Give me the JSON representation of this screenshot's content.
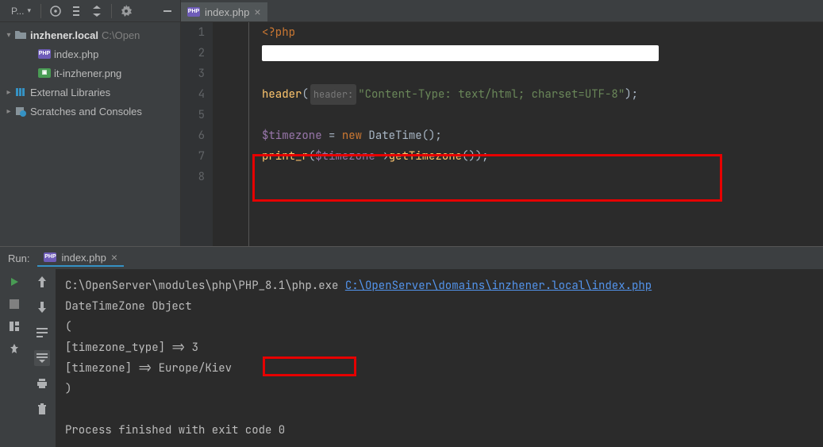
{
  "toolbar": {
    "project_label": "P...",
    "dropdown_icon": "chevron"
  },
  "tree": {
    "root": {
      "name": "inzhener.local",
      "path": "C:\\Open"
    },
    "files": [
      {
        "name": "index.php",
        "type": "php"
      },
      {
        "name": "it-inzhener.png",
        "type": "png"
      }
    ],
    "ext_lib": "External Libraries",
    "scratches": "Scratches and Consoles"
  },
  "tab": {
    "file": "index.php"
  },
  "code": {
    "lines": [
      "1",
      "2",
      "3",
      "4",
      "5",
      "6",
      "7",
      "8"
    ],
    "l1_open": "<?php",
    "l4_fn": "header",
    "l4_p1": "(",
    "l4_hint": "header:",
    "l4_str": "\"Content-Type: text/html; charset=UTF-8\"",
    "l4_p2": ");",
    "l6_var": "$timezone",
    "l6_eq": " = ",
    "l6_new": "new ",
    "l6_cls": "DateTime",
    "l6_end": "();",
    "l7_fn": "print_r",
    "l7_p1": "(",
    "l7_var": "$timezone",
    "l7_arrow": "->",
    "l7_method": "getTimezone",
    "l7_end": "());"
  },
  "run": {
    "title": "Run:",
    "tab_label": "index.php",
    "cmd_prefix": "C:\\OpenServer\\modules\\php\\PHP_8.1\\php.exe ",
    "cmd_link": "C:\\OpenServer\\domains\\inzhener.local\\index.php",
    "out1": "DateTimeZone Object",
    "out2": "(",
    "out3": "    [timezone_type] => 3",
    "out4a": "    [timezone] => ",
    "out4b": "Europe/Kiev",
    "out5": ")",
    "exit": "Process finished with exit code 0"
  }
}
